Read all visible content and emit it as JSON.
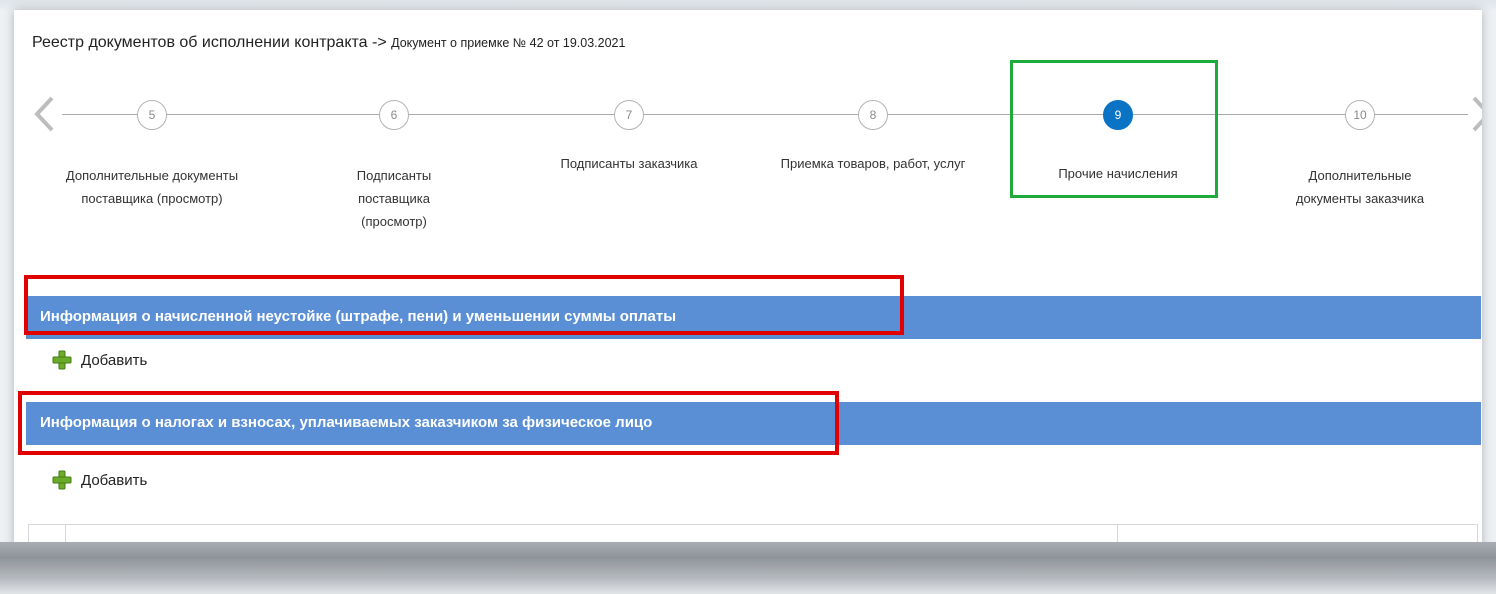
{
  "breadcrumb": {
    "registry": "Реестр документов об исполнении контракта ->",
    "document": "Документ о приемке № 42 от 19.03.2021"
  },
  "stepper": {
    "prev_icon": "chevron-left-icon",
    "next_icon": "chevron-right-icon",
    "steps": [
      {
        "number": "5",
        "label": "Дополнительные документы поставщика (просмотр)",
        "active": false
      },
      {
        "number": "6",
        "label": "Подписанты поставщика (просмотр)",
        "active": false
      },
      {
        "number": "7",
        "label": "Подписанты заказчика",
        "active": false
      },
      {
        "number": "8",
        "label": "Приемка товаров, работ, услуг",
        "active": false
      },
      {
        "number": "9",
        "label": "Прочие начисления",
        "active": true
      },
      {
        "number": "10",
        "label": "Дополнительные документы заказчика",
        "active": false
      }
    ]
  },
  "sections": [
    {
      "title": "Информация о начисленной неустойке (штрафе, пени) и уменьшении суммы оплаты",
      "add_label": "Добавить"
    },
    {
      "title": "Информация о налогах и взносах, уплачиваемых заказчиком за физическое лицо",
      "add_label": "Добавить"
    }
  ],
  "colors": {
    "section_bar": "#5a8fd6",
    "active_step": "#0a73c4",
    "highlight_green": "#1faa3c",
    "highlight_red": "#e00000",
    "add_icon": "#6cab2a"
  }
}
